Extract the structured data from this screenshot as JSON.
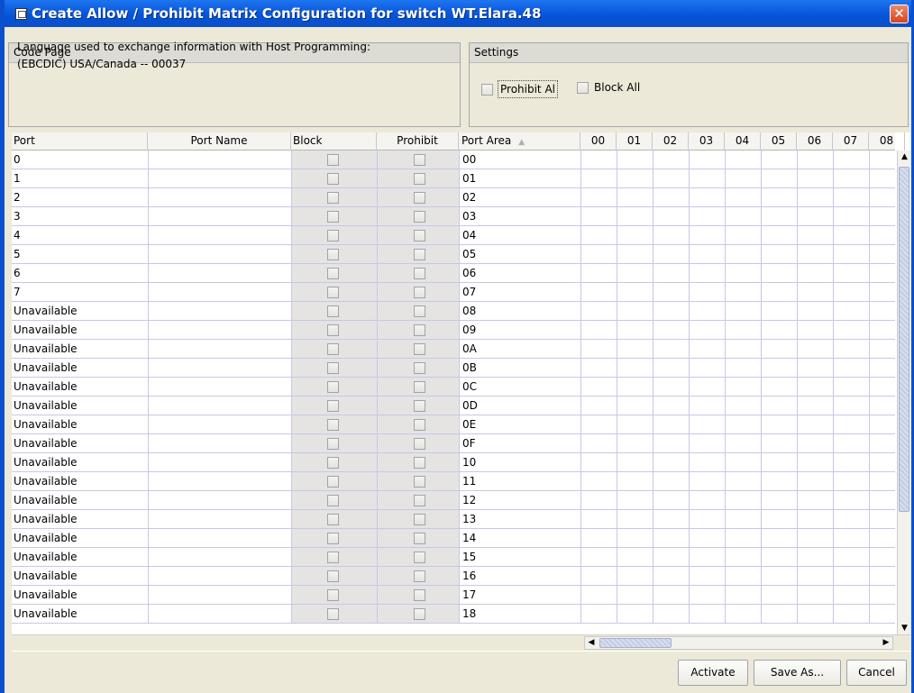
{
  "window": {
    "title": "Create Allow / Prohibit Matrix Configuration for switch WT.Elara.48",
    "close_glyph": "✕"
  },
  "code_page": {
    "header": "Code Page",
    "description": "Language used to exchange information with Host Programming:",
    "value": "(EBCDIC) USA/Canada -- 00037"
  },
  "settings": {
    "header": "Settings",
    "prohibit_all_label": "Prohibit Al",
    "block_all_label": "Block All",
    "prohibit_all_checked": false,
    "block_all_checked": false
  },
  "table": {
    "columns": {
      "port": "Port",
      "port_name": "Port Name",
      "block": "Block",
      "prohibit": "Prohibit",
      "port_area": "Port Area",
      "sort_indicator": "▲"
    },
    "matrix_columns": [
      "00",
      "01",
      "02",
      "03",
      "04",
      "05",
      "06",
      "07",
      "08"
    ],
    "rows": [
      {
        "port": "0",
        "port_name": "",
        "port_area": "00"
      },
      {
        "port": "1",
        "port_name": "",
        "port_area": "01"
      },
      {
        "port": "2",
        "port_name": "",
        "port_area": "02"
      },
      {
        "port": "3",
        "port_name": "",
        "port_area": "03"
      },
      {
        "port": "4",
        "port_name": "",
        "port_area": "04"
      },
      {
        "port": "5",
        "port_name": "",
        "port_area": "05"
      },
      {
        "port": "6",
        "port_name": "",
        "port_area": "06"
      },
      {
        "port": "7",
        "port_name": "",
        "port_area": "07"
      },
      {
        "port": "Unavailable",
        "port_name": "",
        "port_area": "08"
      },
      {
        "port": "Unavailable",
        "port_name": "",
        "port_area": "09"
      },
      {
        "port": "Unavailable",
        "port_name": "",
        "port_area": "0A"
      },
      {
        "port": "Unavailable",
        "port_name": "",
        "port_area": "0B"
      },
      {
        "port": "Unavailable",
        "port_name": "",
        "port_area": "0C"
      },
      {
        "port": "Unavailable",
        "port_name": "",
        "port_area": "0D"
      },
      {
        "port": "Unavailable",
        "port_name": "",
        "port_area": "0E"
      },
      {
        "port": "Unavailable",
        "port_name": "",
        "port_area": "0F"
      },
      {
        "port": "Unavailable",
        "port_name": "",
        "port_area": "10"
      },
      {
        "port": "Unavailable",
        "port_name": "",
        "port_area": "11"
      },
      {
        "port": "Unavailable",
        "port_name": "",
        "port_area": "12"
      },
      {
        "port": "Unavailable",
        "port_name": "",
        "port_area": "13"
      },
      {
        "port": "Unavailable",
        "port_name": "",
        "port_area": "14"
      },
      {
        "port": "Unavailable",
        "port_name": "",
        "port_area": "15"
      },
      {
        "port": "Unavailable",
        "port_name": "",
        "port_area": "16"
      },
      {
        "port": "Unavailable",
        "port_name": "",
        "port_area": "17"
      },
      {
        "port": "Unavailable",
        "port_name": "",
        "port_area": "18"
      }
    ]
  },
  "scrollbars": {
    "up_glyph": "▲",
    "down_glyph": "▼",
    "left_glyph": "◀",
    "right_glyph": "▶"
  },
  "buttons": {
    "activate": "Activate",
    "save_as": "Save As...",
    "cancel": "Cancel"
  },
  "colors": {
    "titlebar": "#0453d6",
    "dialog_bg": "#ece9d8",
    "grid_line": "#c9c6e8",
    "close_button": "#d5451d"
  }
}
